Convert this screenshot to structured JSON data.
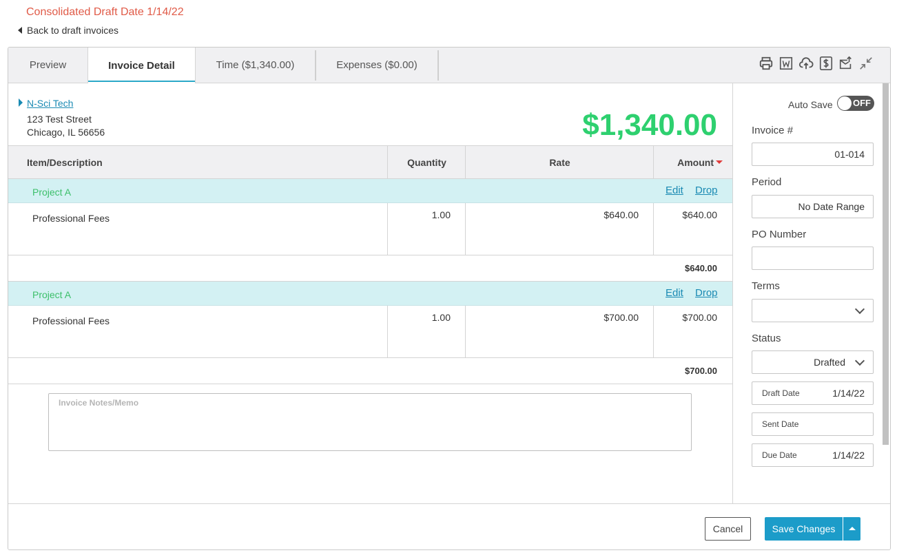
{
  "page": {
    "title": "Consolidated Draft Date 1/14/22",
    "back_label": "Back to draft invoices"
  },
  "tabs": [
    {
      "label": "Preview"
    },
    {
      "label": "Invoice Detail",
      "active": true
    },
    {
      "label": "Time ($1,340.00)"
    },
    {
      "label": "Expenses ($0.00)"
    }
  ],
  "toolbar_icons": [
    "printer-icon",
    "word-icon",
    "upload-cloud-icon",
    "dollar-icon",
    "email-send-icon",
    "collapse-arrows-icon"
  ],
  "client": {
    "name": "N-Sci Tech",
    "address1": "123 Test Street",
    "address2": "Chicago, IL 56656"
  },
  "invoice_total": "$1,340.00",
  "table": {
    "headers": {
      "item": "Item/Description",
      "quantity": "Quantity",
      "rate": "Rate",
      "amount": "Amount"
    },
    "groups": [
      {
        "project": "Project A",
        "edit_label": "Edit",
        "drop_label": "Drop",
        "item": {
          "description": "Professional Fees",
          "quantity": "1.00",
          "rate": "$640.00",
          "amount": "$640.00"
        },
        "subtotal": "$640.00"
      },
      {
        "project": "Project A",
        "edit_label": "Edit",
        "drop_label": "Drop",
        "item": {
          "description": "Professional Fees",
          "quantity": "1.00",
          "rate": "$700.00",
          "amount": "$700.00"
        },
        "subtotal": "$700.00"
      }
    ]
  },
  "notes": {
    "placeholder": "Invoice Notes/Memo",
    "value": ""
  },
  "sidebar": {
    "autosave_label": "Auto Save",
    "autosave_state": "OFF",
    "invoice_number_label": "Invoice #",
    "invoice_number": "01-014",
    "period_label": "Period",
    "period": "No Date Range",
    "po_label": "PO Number",
    "po_value": "",
    "terms_label": "Terms",
    "terms_value": "",
    "status_label": "Status",
    "status_value": "Drafted",
    "draft_date_label": "Draft Date",
    "draft_date": "1/14/22",
    "sent_date_label": "Sent Date",
    "sent_date": "",
    "due_date_label": "Due Date",
    "due_date": "1/14/22"
  },
  "footer": {
    "cancel_label": "Cancel",
    "save_label": "Save Changes"
  },
  "colors": {
    "title_red": "#e05a47",
    "total_green": "#2ed06f",
    "accent_blue": "#1c9cc9",
    "project_row_bg": "#d3f1f3"
  }
}
